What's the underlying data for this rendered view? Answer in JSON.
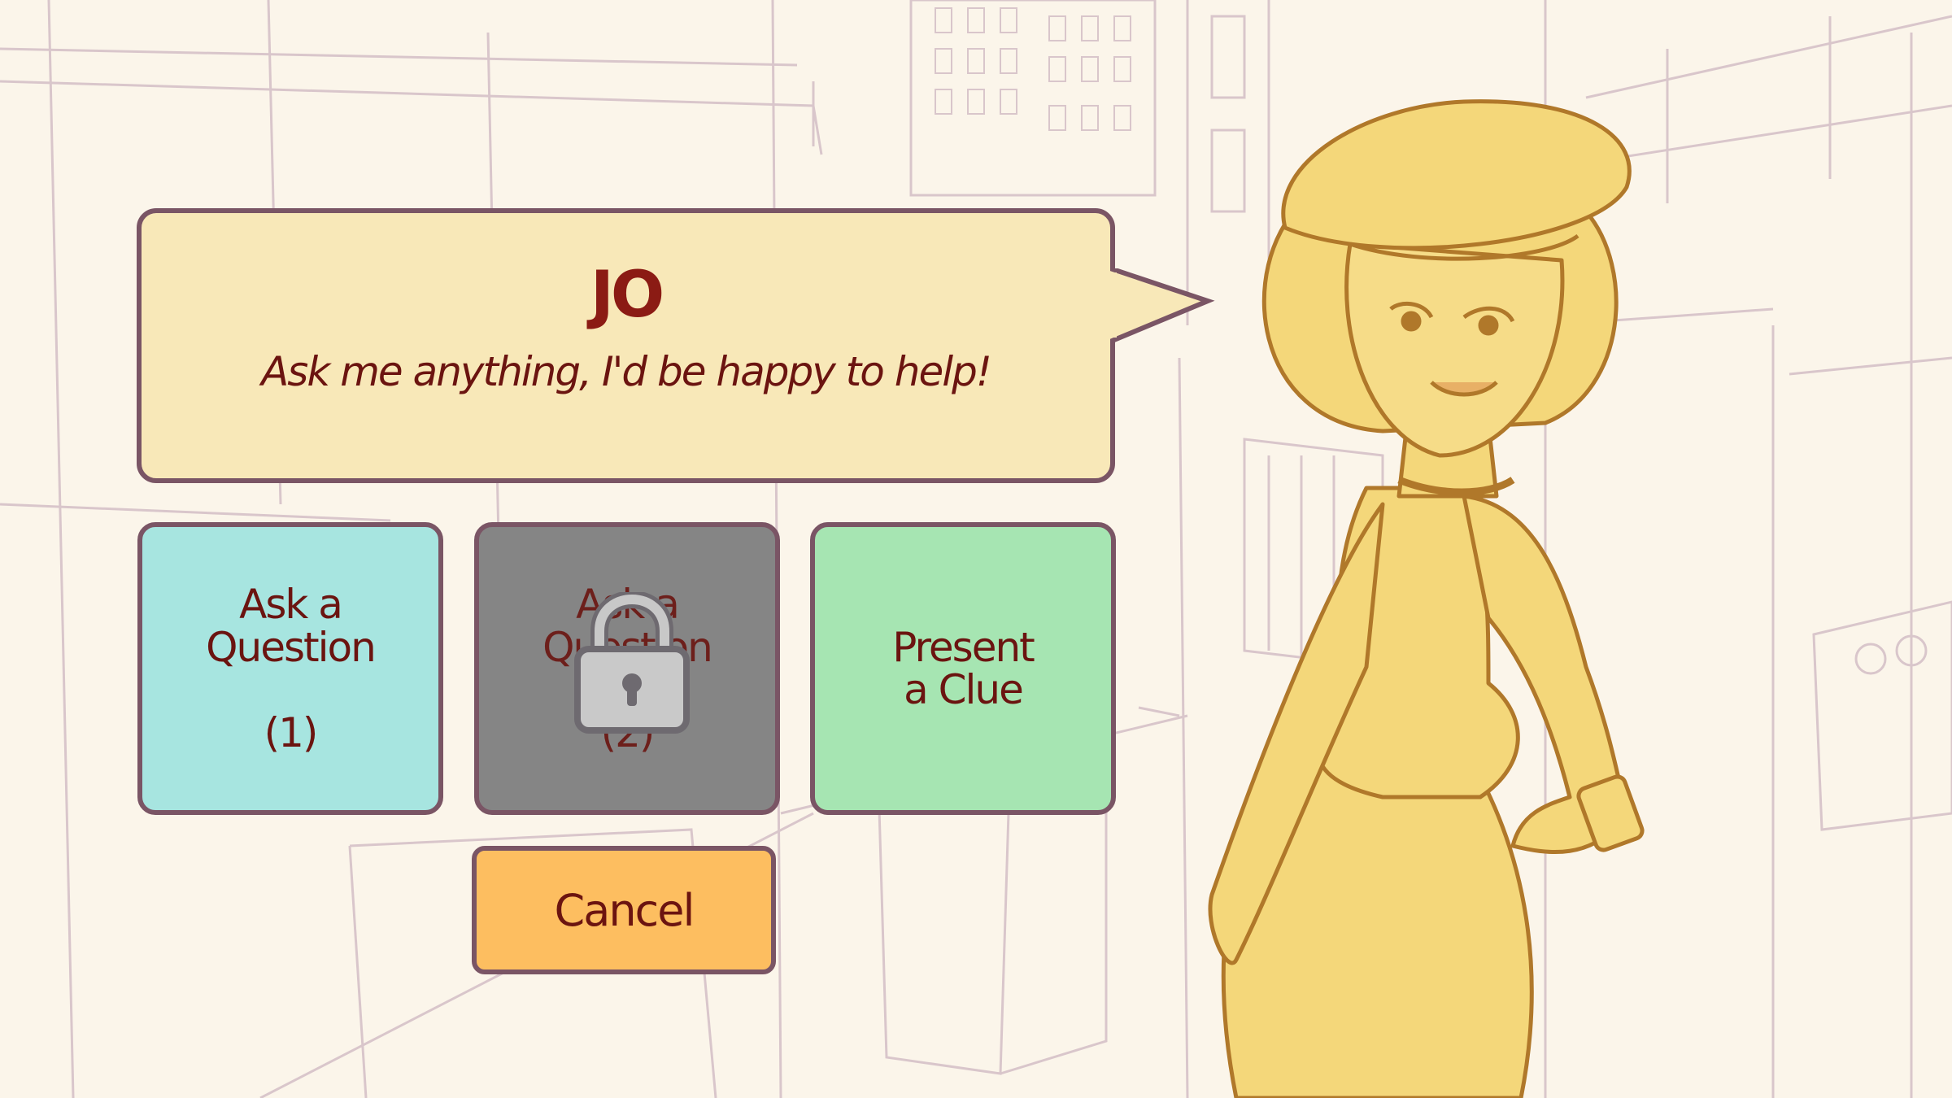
{
  "dialog": {
    "speaker": "JO",
    "text": "Ask me anything, I'd be happy to help!"
  },
  "choices": [
    {
      "label": "Ask a\nQuestion\n\n(1)",
      "state": "available",
      "color": "#a7e5e0"
    },
    {
      "label": "Ask a\nQuestion\n\n(2)",
      "state": "locked",
      "color": "#858585",
      "icon": "lock-icon"
    },
    {
      "label": "Present\na Clue",
      "state": "available",
      "color": "#a6e5b2"
    }
  ],
  "cancel": {
    "label": "Cancel",
    "color": "#fdbe60"
  },
  "colors": {
    "outline": "#7a5565",
    "text": "#6b1410",
    "bubble": "#f8e8b8",
    "background": "#fbf5ea",
    "character_fill": "#f4d77a",
    "character_line": "#b0782a",
    "sketch_line": "#d8c4c8"
  },
  "character": {
    "icon": "character-portrait"
  }
}
